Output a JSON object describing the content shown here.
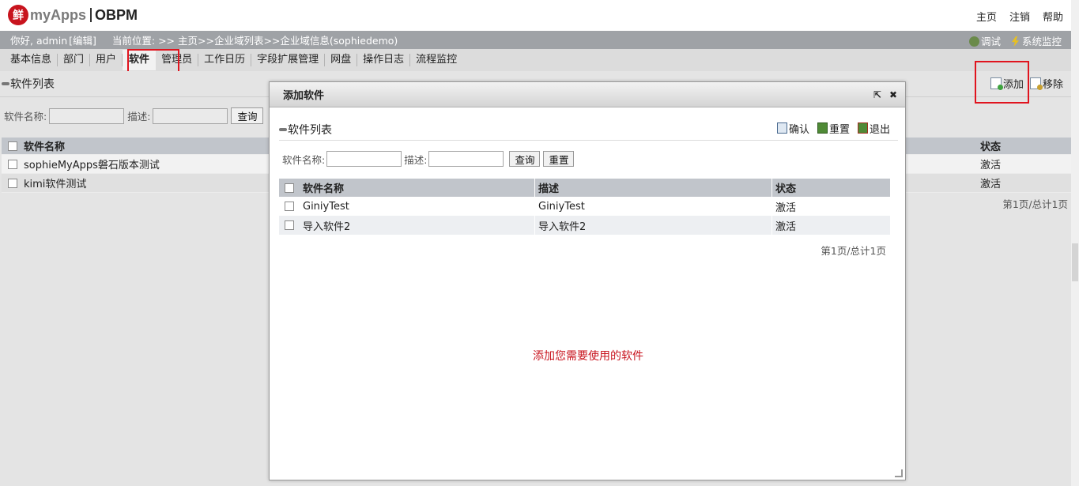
{
  "header": {
    "logo_mark": "鲜",
    "logo_text": "myApps",
    "logo_sub": "OBPM",
    "links": [
      "主页",
      "注销",
      "帮助"
    ]
  },
  "infobar": {
    "greeting": "你好, admin",
    "edit": "[编辑]",
    "location": "当前位置: >> 主页>>企业域列表>>企业域信息(sophiedemo)",
    "debug": "调试",
    "monitor": "系统监控"
  },
  "tabs": [
    "基本信息",
    "部门",
    "用户",
    "软件",
    "管理员",
    "工作日历",
    "字段扩展管理",
    "网盘",
    "操作日志",
    "流程监控"
  ],
  "main": {
    "title": "软件列表",
    "add": "添加",
    "remove": "移除",
    "search": {
      "name_label": "软件名称:",
      "desc_label": "描述:",
      "query": "查询"
    },
    "columns": [
      "软件名称",
      "状态"
    ],
    "rows": [
      {
        "name": "sophieMyApps磐石版本测试",
        "status": "激活"
      },
      {
        "name": "kimi软件测试",
        "status": "激活"
      }
    ],
    "pager": "第1页/总计1页"
  },
  "modal": {
    "title": "添加软件",
    "list_title": "软件列表",
    "actions": [
      "确认",
      "重置",
      "退出"
    ],
    "search": {
      "name_label": "软件名称:",
      "desc_label": "描述:",
      "query": "查询",
      "reset": "重置"
    },
    "columns": [
      "软件名称",
      "描述",
      "状态"
    ],
    "rows": [
      {
        "name": "GiniyTest",
        "desc": "GiniyTest",
        "status": "激活"
      },
      {
        "name": "导入软件2",
        "desc": "导入软件2",
        "status": "激活"
      }
    ],
    "pager": "第1页/总计1页",
    "note": "添加您需要使用的软件"
  },
  "colors": {
    "highlight": "#e0141e",
    "note": "#c8141e"
  }
}
